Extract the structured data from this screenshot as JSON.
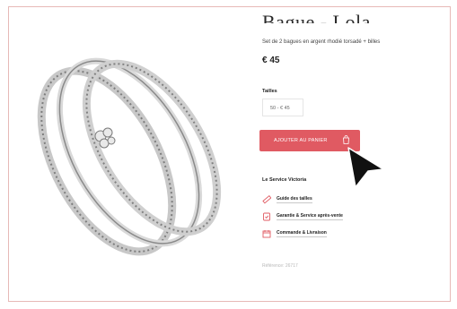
{
  "product": {
    "title": "Bague - Lola",
    "subtitle": "Set de 2 bagues en argent rhodié torsadé + billes",
    "price": "€ 45"
  },
  "size": {
    "label": "Tailles",
    "selected": "50 - € 45"
  },
  "cart": {
    "add_label": "AJOUTER AU PANIER"
  },
  "service": {
    "title": "Le Service Victoria",
    "items": [
      {
        "label": "Guide des tailles",
        "icon": "ruler-icon"
      },
      {
        "label": "Garantie & Service après-vente",
        "icon": "shield-icon"
      },
      {
        "label": "Commande & Livraison",
        "icon": "calendar-icon"
      }
    ]
  },
  "reference": "Référence: 26717",
  "colors": {
    "accent": "#e05a62",
    "frame_border": "#e7b9b7"
  }
}
